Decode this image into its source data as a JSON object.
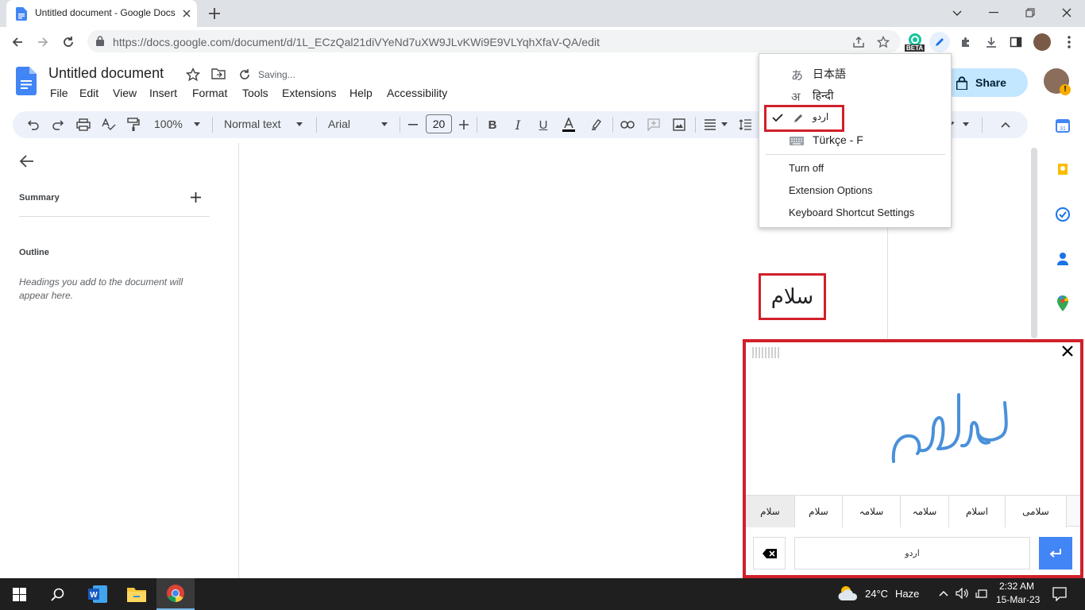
{
  "browser": {
    "tab_title": "Untitled document - Google Docs",
    "url": "https://docs.google.com/document/d/1L_ECzQal21diVYeNd7uXW9JLvKWi9E9VLYqhXfaV-QA/edit",
    "extension_badge": "BETA"
  },
  "docs": {
    "title": "Untitled document",
    "saving_status": "Saving...",
    "menu": [
      "File",
      "Edit",
      "View",
      "Insert",
      "Format",
      "Tools",
      "Extensions",
      "Help",
      "Accessibility"
    ],
    "share_label": "Share",
    "toolbar": {
      "zoom": "100%",
      "style": "Normal text",
      "font": "Arial",
      "font_size": "20"
    },
    "outline": {
      "summary_label": "Summary",
      "outline_label": "Outline",
      "hint": "Headings you add to the document will appear here."
    },
    "typed_text": "سلام"
  },
  "extension_menu": {
    "languages": [
      {
        "icon": "あ",
        "label": "日本語",
        "checked": false
      },
      {
        "icon": "अ",
        "label": "हिन्दी",
        "checked": false
      },
      {
        "icon": "pencil-icon",
        "label": "اردو",
        "checked": true
      },
      {
        "icon": "keyboard-icon",
        "label": "Türkçe - F",
        "checked": false
      }
    ],
    "options": [
      "Turn off",
      "Extension Options",
      "Keyboard Shortcut Settings"
    ]
  },
  "handwriting": {
    "candidates": [
      "سلام",
      "سلام",
      "سلامہ",
      "سلامہ",
      "اسلام",
      "سلامی"
    ],
    "space_label": "اردو"
  },
  "taskbar": {
    "temperature": "24°C",
    "condition": "Haze",
    "time": "2:32 AM",
    "date": "15-Mar-23"
  },
  "colors": {
    "highlight_red": "#d0202a",
    "share_bg": "#c2e7ff",
    "enter_blue": "#4285f4",
    "ink_blue": "#4a90d9"
  }
}
